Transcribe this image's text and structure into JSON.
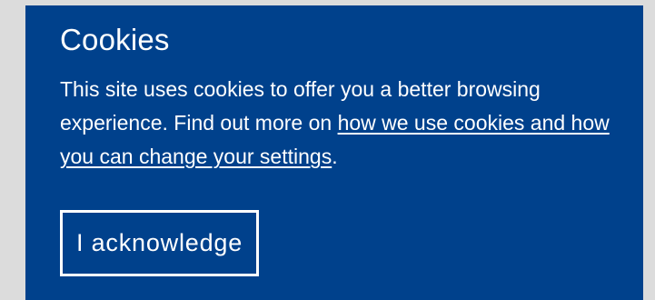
{
  "cookie_banner": {
    "title": "Cookies",
    "text_before_link": "This site uses cookies to offer you a better browsing experience. Find out more on ",
    "link_text": "how we use cookies and how you can change your settings",
    "text_after_link": ".",
    "button_label": "I acknowledge"
  },
  "colors": {
    "banner_background": "#00418c",
    "page_background": "#dcdcdc",
    "text": "#ffffff"
  }
}
